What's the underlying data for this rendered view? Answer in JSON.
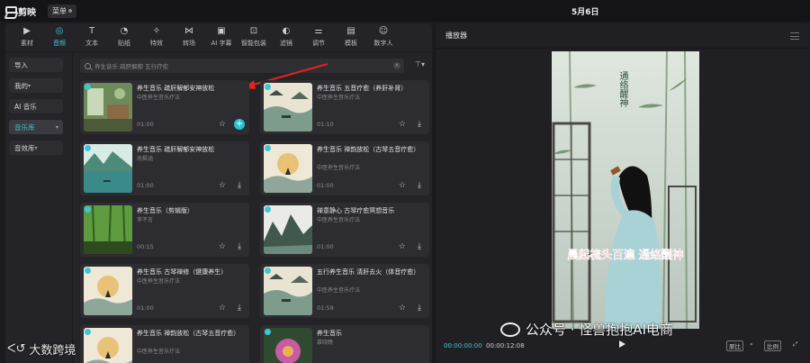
{
  "app": {
    "logo": "剪映",
    "menu_label": "菜单",
    "date_title": "5月6日"
  },
  "toolbar": [
    {
      "label": "素材",
      "icon": "media-icon",
      "glyph": "▶"
    },
    {
      "label": "音频",
      "icon": "audio-icon",
      "glyph": "◎",
      "active": true
    },
    {
      "label": "文本",
      "icon": "text-icon",
      "glyph": "T"
    },
    {
      "label": "贴纸",
      "icon": "sticker-icon",
      "glyph": "◔"
    },
    {
      "label": "特效",
      "icon": "effects-icon",
      "glyph": "✧"
    },
    {
      "label": "转场",
      "icon": "transition-icon",
      "glyph": "⋈"
    },
    {
      "label": "AI 字幕",
      "icon": "ai-subtitle-icon",
      "glyph": "▣"
    },
    {
      "label": "智能包装",
      "icon": "smart-pack-icon",
      "glyph": "⊡"
    },
    {
      "label": "滤镜",
      "icon": "filter-icon",
      "glyph": "◐"
    },
    {
      "label": "调节",
      "icon": "adjust-icon",
      "glyph": "⚌"
    },
    {
      "label": "模板",
      "icon": "template-icon",
      "glyph": "▤"
    },
    {
      "label": "数字人",
      "icon": "digital-human-icon",
      "glyph": "☺"
    }
  ],
  "sidenav": [
    {
      "label": "导入"
    },
    {
      "label": "我的",
      "chevron": true
    },
    {
      "label": "AI 音乐"
    },
    {
      "label": "音乐库",
      "chevron": true,
      "active": true
    },
    {
      "label": "音效库",
      "chevron": true
    }
  ],
  "search": {
    "placeholder": "养生音乐 疏肝解郁 五行疗愈"
  },
  "cards": [
    {
      "title": "养生音乐 疏肝解郁安神放松",
      "subtitle": "中医养生音乐疗法",
      "duration": "01:00",
      "add": true,
      "scene": "room"
    },
    {
      "title": "养生音乐 五音疗愈（养肝补肾）",
      "subtitle": "中医养生音乐疗法",
      "duration": "01:10",
      "scene": "river"
    },
    {
      "title": "养生音乐 疏肝解郁安神放松",
      "subtitle": "尚枫涵",
      "duration": "01:00",
      "scene": "lake"
    },
    {
      "title": "养生音乐 禅韵放松（古琴五音疗愈）",
      "subtitle": "中医养生音乐疗法",
      "duration": "01:00",
      "scene": "sun"
    },
    {
      "title": "养生音乐（剪辑版）",
      "subtitle": "李不言",
      "duration": "00:15",
      "scene": "bamboo"
    },
    {
      "title": "禅意静心 古琴疗愈冥想音乐",
      "subtitle": "中医养生音乐疗法",
      "duration": "01:00",
      "scene": "mountain"
    },
    {
      "title": "养生音乐 古琴禅修（健康养生）",
      "subtitle": "中医养生音乐疗法",
      "duration": "01:00",
      "scene": "sun"
    },
    {
      "title": "五行养生音乐 清肝去火（体音疗愈）",
      "subtitle": "中医养生音乐疗法",
      "duration": "01:59",
      "scene": "river"
    },
    {
      "title": "养生音乐 禅韵放松（古琴五音疗愈）",
      "subtitle": "中医养生音乐疗法",
      "duration": "",
      "scene": "sun"
    },
    {
      "title": "养生音乐",
      "subtitle": "慕晓晚",
      "duration": "",
      "scene": "lotus"
    }
  ],
  "player": {
    "title": "播放器",
    "current_time": "00:00:00:00",
    "total_time": "00:00:12:08",
    "caption_top": "通络醒神",
    "caption_bottom": "晨起梳头百遍 通络醒神",
    "ratio_label": "原比",
    "ratio_box": "比例"
  },
  "watermark": {
    "text": "公众号 · 怪兽抱抱AI电商"
  },
  "corner_brand": {
    "text": "大数跨境"
  }
}
